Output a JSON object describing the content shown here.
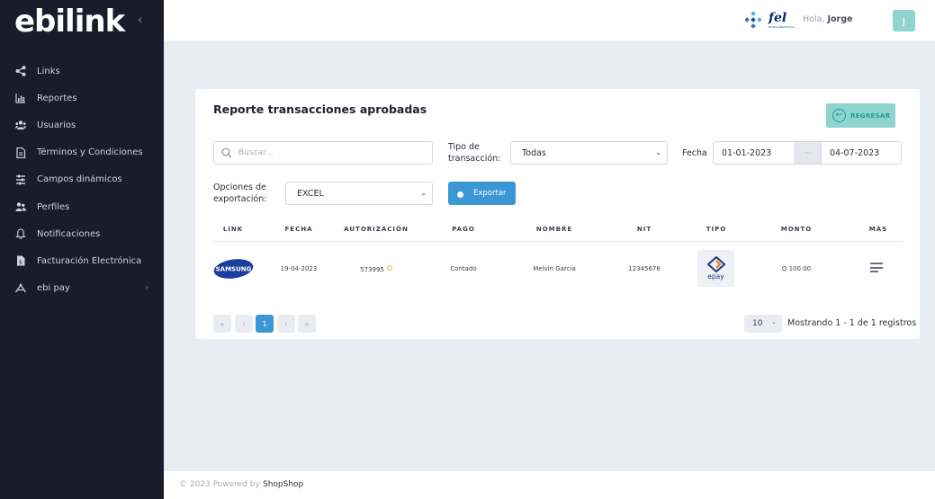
{
  "brand": {
    "logo_text": "ebilink",
    "collapse_glyph": "‹"
  },
  "sidebar": {
    "items": [
      {
        "label": "Links",
        "icon": "share-icon"
      },
      {
        "label": "Reportes",
        "icon": "bar-chart-icon"
      },
      {
        "label": "Usuarios",
        "icon": "users-icon"
      },
      {
        "label": "Términos y Condiciones",
        "icon": "document-icon"
      },
      {
        "label": "Campos dinámicos",
        "icon": "filter-icon"
      },
      {
        "label": "Perfiles",
        "icon": "profiles-icon"
      },
      {
        "label": "Notificaciones",
        "icon": "bell-icon"
      },
      {
        "label": "Facturación Electrónica",
        "icon": "invoice-icon"
      },
      {
        "label": "ebi pay",
        "icon": "ebipay-icon",
        "chevron": "›"
      }
    ]
  },
  "header": {
    "fel_logo": "fel",
    "fel_tagline": "Factura Electrónica",
    "greeting": "Hola, ",
    "user_name": "Jorge",
    "avatar_initial": "J"
  },
  "report": {
    "title": "Reporte transacciones aprobadas",
    "back_button": "REGRESAR",
    "search_placeholder": "Buscar...",
    "transaction_type_label": "Tipo de transacción:",
    "transaction_type_value": "Todas",
    "date_label": "Fecha",
    "date_from": "01-01-2023",
    "date_sep": "···",
    "date_to": "04-07-2023",
    "export_label": "Opciones de exportación:",
    "export_value": "EXCEL",
    "export_button": "Exportar"
  },
  "table": {
    "columns": [
      "LINK",
      "FECHA",
      "AUTORIZACIÓN",
      "PAGO",
      "NOMBRE",
      "NIT",
      "TIPO",
      "MONTO",
      "MÁS"
    ],
    "rows": [
      {
        "link_logo": "SAMSUNG",
        "fecha": "19-04-2023",
        "autorizacion": "573995",
        "pago": "Contado",
        "nombre": "Melvin Garcia",
        "nit": "12345678",
        "tipo": "epay",
        "monto": "Q 100.00"
      }
    ]
  },
  "pagination": {
    "first": "«",
    "prev": "‹",
    "current": "1",
    "next": "›",
    "last": "»",
    "page_size": "10",
    "summary": "Mostrando 1 - 1 de 1 registros"
  },
  "footer": {
    "text": "© 2023 Powered by",
    "brand": "ShopShop"
  },
  "colors": {
    "sidebar": "#181c2b",
    "accent_teal": "#8fd4cf",
    "primary_blue": "#3a97d4",
    "background": "#e9ecf3"
  }
}
